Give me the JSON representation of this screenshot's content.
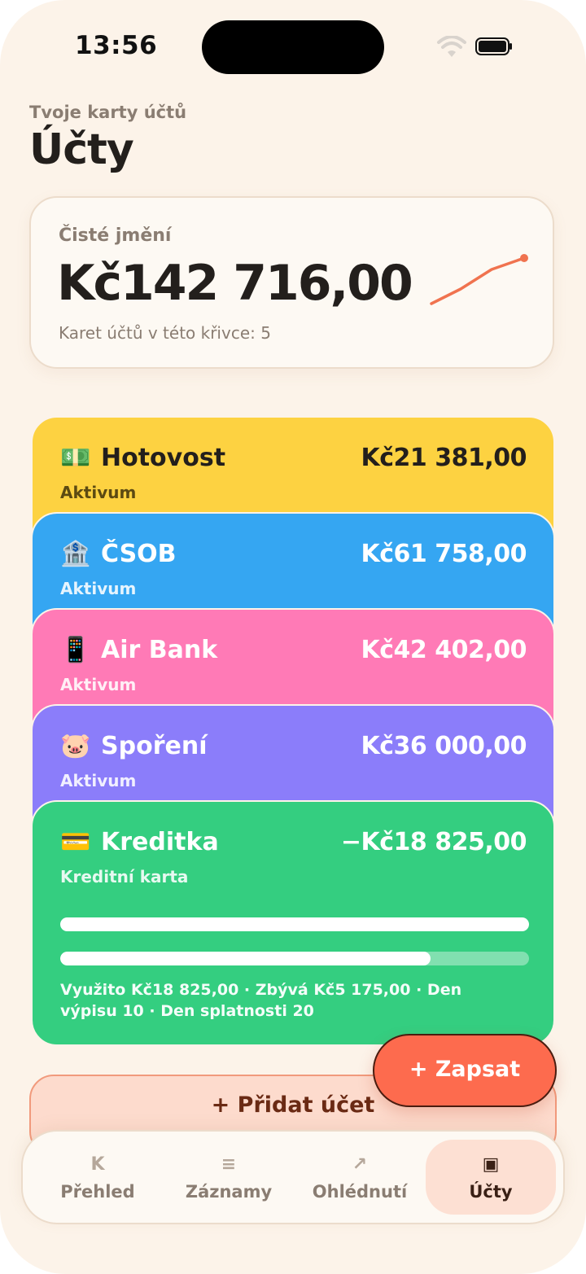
{
  "status_bar": {
    "time": "13:56"
  },
  "header": {
    "subtitle": "Tvoje karty účtů",
    "title": "Účty"
  },
  "net_worth": {
    "label": "Čisté jmění",
    "amount": "Kč142 716,00",
    "caption": "Karet účtů v této křivce: 5",
    "trend_color": "#f0734f"
  },
  "accounts": [
    {
      "emoji": "💵",
      "name": "Hotovost",
      "amount": "Kč21 381,00",
      "type": "Aktivum",
      "color": "#fdd241"
    },
    {
      "emoji": "🏦",
      "name": "ČSOB",
      "amount": "Kč61 758,00",
      "type": "Aktivum",
      "color": "#35a6f2"
    },
    {
      "emoji": "📱",
      "name": "Air Bank",
      "amount": "Kč42 402,00",
      "type": "Aktivum",
      "color": "#ff7ab6"
    },
    {
      "emoji": "🐷",
      "name": "Spoření",
      "amount": "Kč36 000,00",
      "type": "Aktivum",
      "color": "#8b7dfa"
    },
    {
      "emoji": "💳",
      "name": "Kreditka",
      "amount": "−Kč18 825,00",
      "type": "Kreditní karta",
      "color": "#34ce80",
      "credit_used_fraction": 0.79,
      "info": "Využito Kč18 825,00 · Zbývá Kč5 175,00 · Den výpisu 10 · Den splatnosti 20"
    }
  ],
  "add_account": {
    "label": "+ Přidat účet"
  },
  "fab": {
    "label": "+ Zapsat"
  },
  "tabs": [
    {
      "icon": "K",
      "label": "Přehled",
      "active": false
    },
    {
      "icon": "≡",
      "label": "Záznamy",
      "active": false
    },
    {
      "icon": "↗",
      "label": "Ohlédnutí",
      "active": false
    },
    {
      "icon": "▣",
      "label": "Účty",
      "active": true
    }
  ]
}
